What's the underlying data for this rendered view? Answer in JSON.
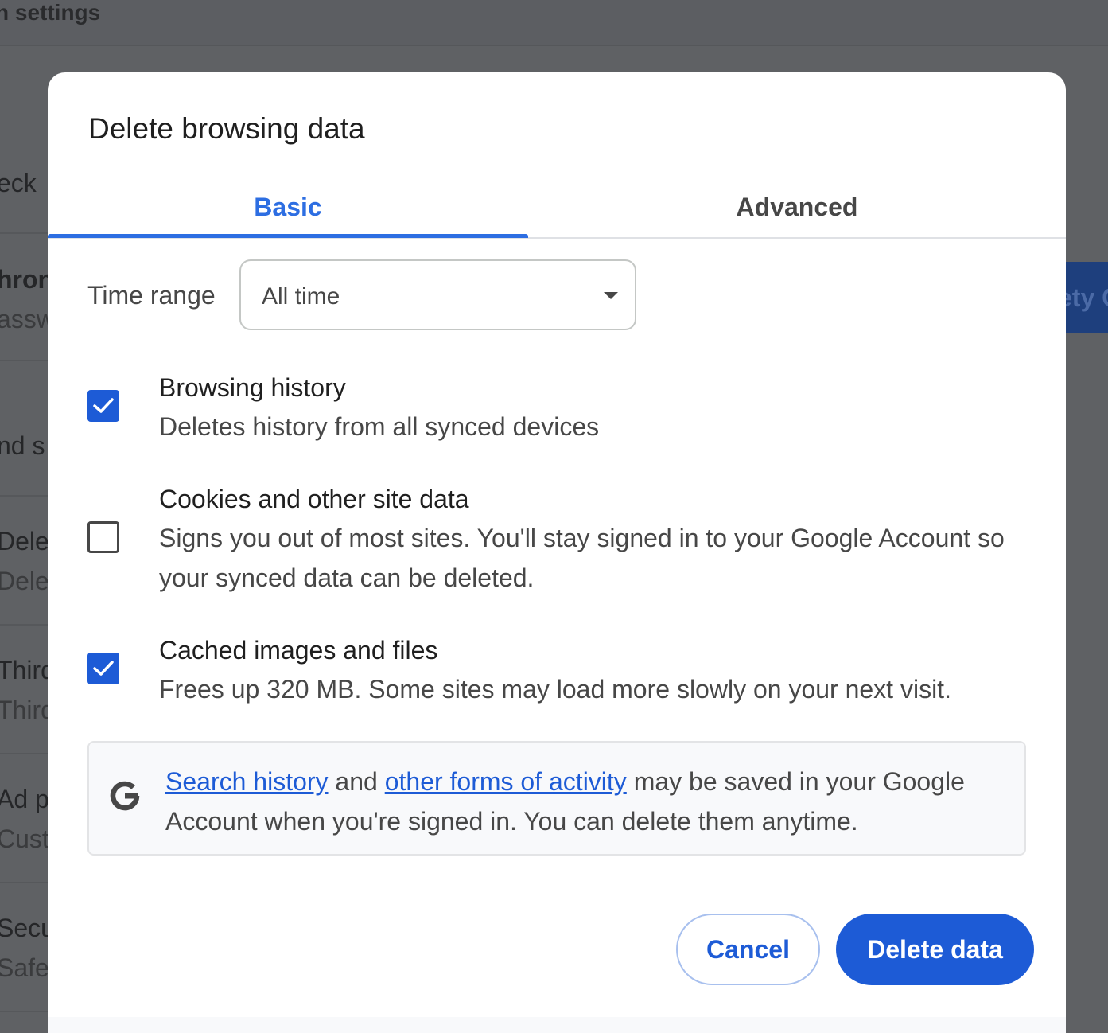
{
  "background": {
    "header_title": "n settings",
    "rows": [
      {
        "title": "eck",
        "sub": ""
      },
      {
        "title": "hron",
        "sub": "assw"
      },
      {
        "title": "nd s",
        "sub": ""
      },
      {
        "title": "Delet",
        "sub": "Delet"
      },
      {
        "title": "Third",
        "sub": "Third"
      },
      {
        "title": "Ad p",
        "sub": "Custo"
      },
      {
        "title": "Secu",
        "sub": "Safe"
      }
    ],
    "right_button_label": "ety C"
  },
  "dialog": {
    "title": "Delete browsing data",
    "tabs": [
      {
        "label": "Basic",
        "selected": true
      },
      {
        "label": "Advanced",
        "selected": false
      }
    ],
    "time_range": {
      "label": "Time range",
      "value": "All time"
    },
    "options": [
      {
        "title": "Browsing history",
        "description": "Deletes history from all synced devices",
        "checked": true
      },
      {
        "title": "Cookies and other site data",
        "description": "Signs you out of most sites. You'll stay signed in to your Google Account so your synced data can be deleted.",
        "checked": false
      },
      {
        "title": "Cached images and files",
        "description": "Frees up 320 MB. Some sites may load more slowly on your next visit.",
        "checked": true
      }
    ],
    "info": {
      "icon": "google-g-icon",
      "link1": "Search history",
      "text1": " and ",
      "link2": "other forms of activity",
      "text2": " may be saved in your Google Account when you're signed in. You can delete them anytime."
    },
    "buttons": {
      "cancel": "Cancel",
      "delete": "Delete data"
    }
  },
  "colors": {
    "accent": "#1d5bd6",
    "tab_active": "#2d6ee2",
    "scrim": "#5f6164"
  }
}
